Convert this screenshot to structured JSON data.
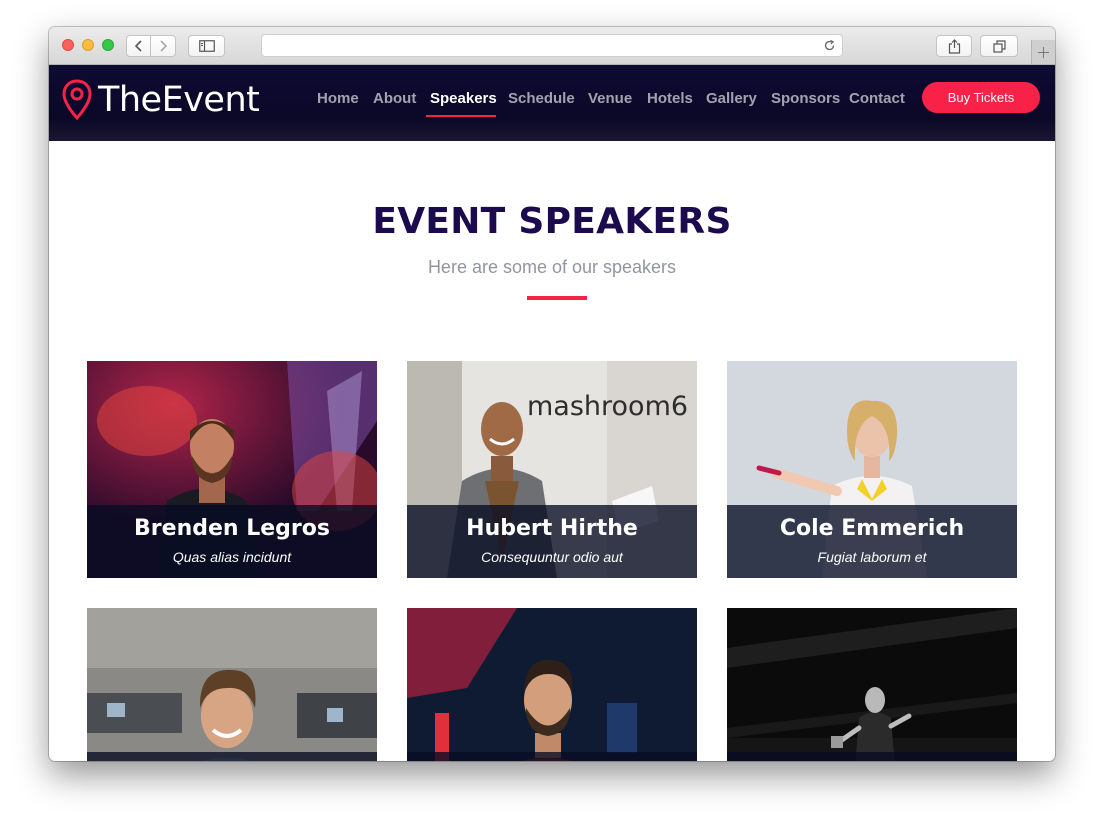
{
  "site": {
    "logo": "TheEvent",
    "nav": [
      {
        "label": "Home",
        "active": false
      },
      {
        "label": "About",
        "active": false
      },
      {
        "label": "Speakers",
        "active": true
      },
      {
        "label": "Schedule",
        "active": false
      },
      {
        "label": "Venue",
        "active": false
      },
      {
        "label": "Hotels",
        "active": false
      },
      {
        "label": "Gallery",
        "active": false
      },
      {
        "label": "Sponsors",
        "active": false
      },
      {
        "label": "Contact",
        "active": false
      }
    ],
    "cta": "Buy Tickets"
  },
  "section": {
    "title": "EVENT SPEAKERS",
    "subtitle": "Here are some of our speakers"
  },
  "speakers": [
    {
      "name": "Brenden Legros",
      "role": "Quas alias incidunt"
    },
    {
      "name": "Hubert Hirthe",
      "role": "Consequuntur odio aut",
      "photo_sign": "mashroom6"
    },
    {
      "name": "Cole Emmerich",
      "role": "Fugiat laborum et"
    },
    {
      "name": "",
      "role": ""
    },
    {
      "name": "",
      "role": ""
    },
    {
      "name": "",
      "role": ""
    }
  ],
  "colors": {
    "accent": "#f82249",
    "header_bg": "#0e0a33",
    "title": "#1b0a4d",
    "subtitle": "#9195a2"
  },
  "icons": [
    "back-arrow-icon",
    "forward-arrow-icon",
    "sidebar-icon",
    "reload-icon",
    "share-icon",
    "tabs-icon",
    "plus-icon",
    "map-pin-icon"
  ]
}
